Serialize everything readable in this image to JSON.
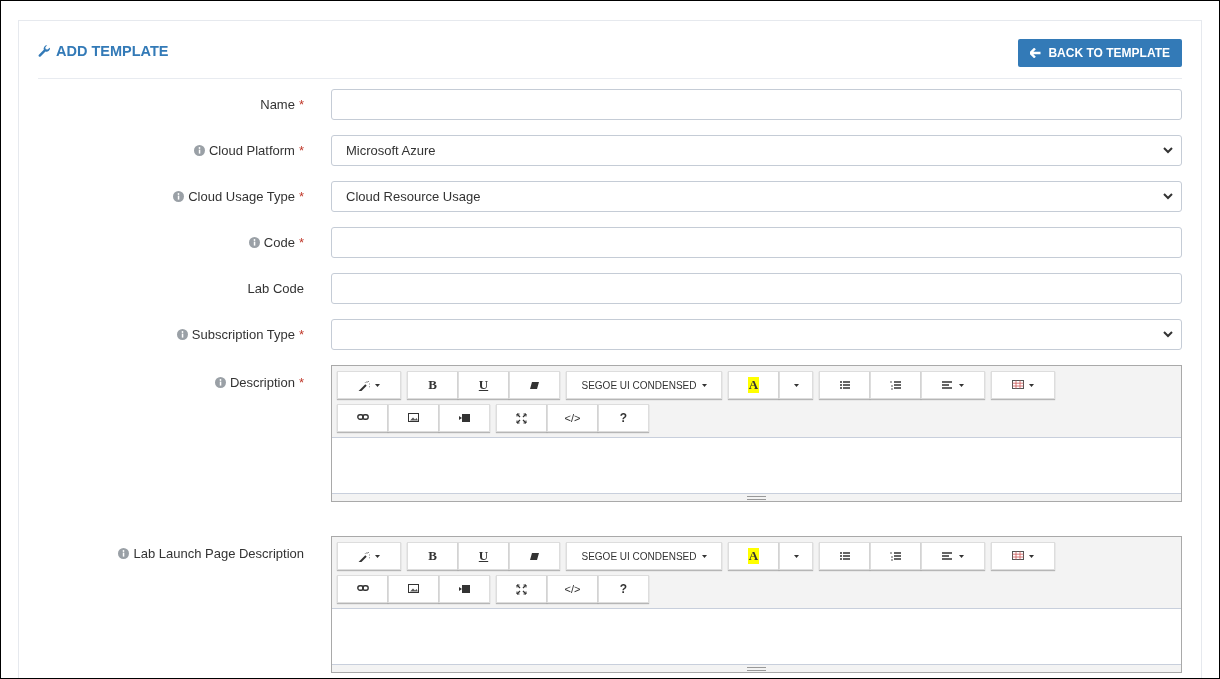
{
  "header": {
    "title": "ADD TEMPLATE",
    "back_button": "BACK TO TEMPLATE"
  },
  "fields": [
    {
      "kind": "text",
      "label": "Name",
      "info": false,
      "required": true
    },
    {
      "kind": "select",
      "label": "Cloud Platform",
      "info": true,
      "required": true,
      "value": "Microsoft Azure"
    },
    {
      "kind": "select",
      "label": "Cloud Usage Type",
      "info": true,
      "required": true,
      "value": "Cloud Resource Usage"
    },
    {
      "kind": "text",
      "label": "Code",
      "info": true,
      "required": true
    },
    {
      "kind": "text",
      "label": "Lab Code",
      "info": false,
      "required": false
    },
    {
      "kind": "select",
      "label": "Subscription Type",
      "info": true,
      "required": true
    },
    {
      "kind": "editor",
      "label": "Description",
      "info": true,
      "required": true,
      "toolbar": {
        "bold": "B",
        "underline": "U",
        "font": "SEGOE UI CONDENSED",
        "highlight": "A",
        "code": "</>",
        "help": "?"
      }
    },
    {
      "kind": "editor",
      "label": "Lab Launch Page Description",
      "info": true,
      "required": false,
      "toolbar": {
        "bold": "B",
        "underline": "U",
        "font": "SEGOE UI CONDENSED",
        "highlight": "A",
        "code": "</>",
        "help": "?"
      }
    }
  ],
  "required_mark": "*"
}
